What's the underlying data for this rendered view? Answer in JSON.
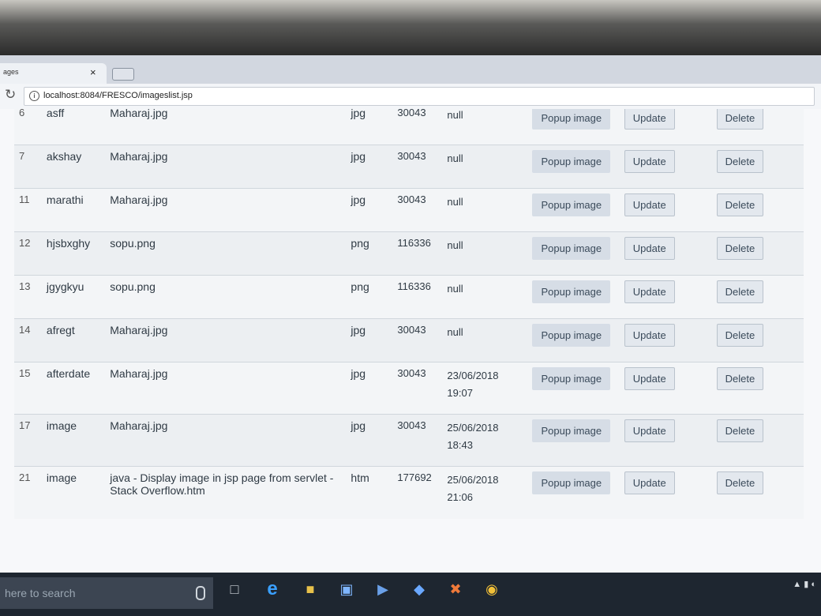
{
  "browser": {
    "tab_title": "ages",
    "tab_close": "×",
    "url": "localhost:8084/FRESCO/imageslist.jsp"
  },
  "rows": [
    {
      "id": "6",
      "name": "asff",
      "file": "Maharaj.jpg",
      "ext": "jpg",
      "size": "30043",
      "date": "null",
      "time": ""
    },
    {
      "id": "7",
      "name": "akshay",
      "file": "Maharaj.jpg",
      "ext": "jpg",
      "size": "30043",
      "date": "null",
      "time": ""
    },
    {
      "id": "11",
      "name": "marathi",
      "file": "Maharaj.jpg",
      "ext": "jpg",
      "size": "30043",
      "date": "null",
      "time": ""
    },
    {
      "id": "12",
      "name": "hjsbxghy",
      "file": "sopu.png",
      "ext": "png",
      "size": "116336",
      "date": "null",
      "time": ""
    },
    {
      "id": "13",
      "name": "jgygkyu",
      "file": "sopu.png",
      "ext": "png",
      "size": "116336",
      "date": "null",
      "time": ""
    },
    {
      "id": "14",
      "name": "afregt",
      "file": "Maharaj.jpg",
      "ext": "jpg",
      "size": "30043",
      "date": "null",
      "time": ""
    },
    {
      "id": "15",
      "name": "afterdate",
      "file": "Maharaj.jpg",
      "ext": "jpg",
      "size": "30043",
      "date": "23/06/2018",
      "time": "19:07"
    },
    {
      "id": "17",
      "name": "image",
      "file": "Maharaj.jpg",
      "ext": "jpg",
      "size": "30043",
      "date": "25/06/2018",
      "time": "18:43"
    },
    {
      "id": "21",
      "name": "image",
      "file": "java - Display image in jsp page from servlet - Stack Overflow.htm",
      "ext": "htm",
      "size": "177692",
      "date": "25/06/2018",
      "time": "21:06"
    }
  ],
  "buttons": {
    "popup": "Popup image",
    "update": "Update",
    "delete": "Delete"
  },
  "taskbar": {
    "search_placeholder": "here to search"
  }
}
